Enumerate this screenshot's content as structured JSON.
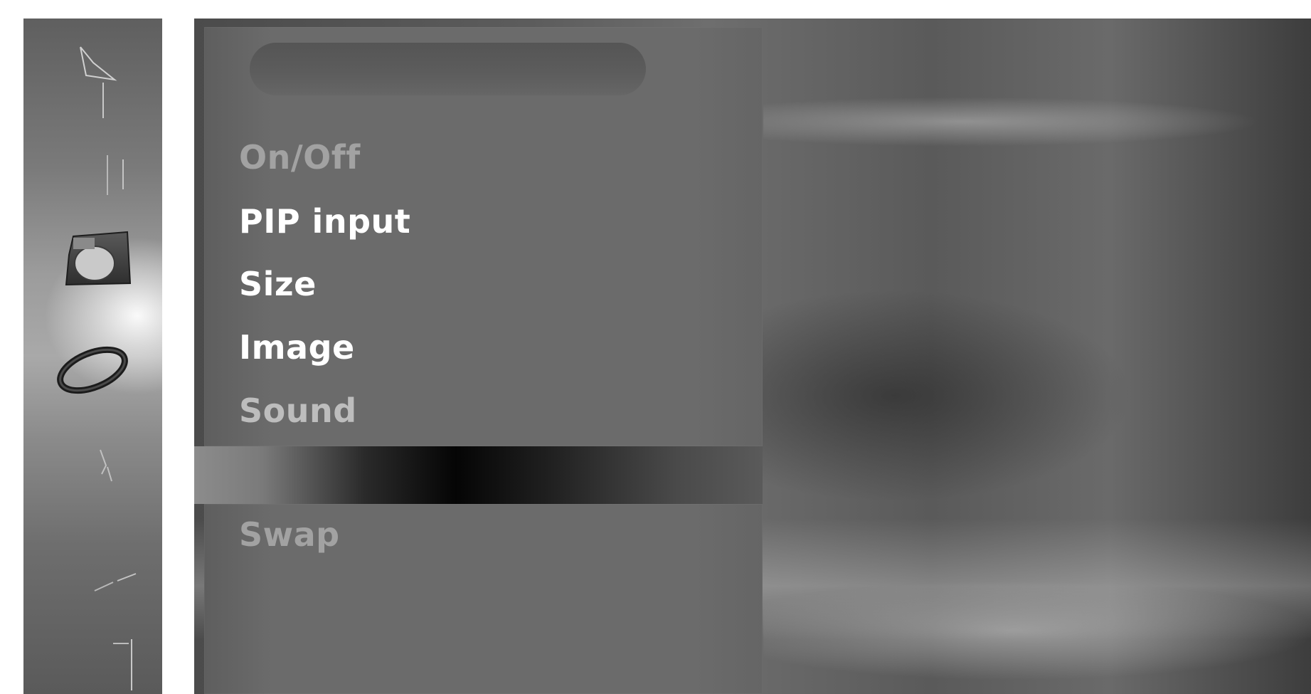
{
  "colors": {
    "item_enabled": "#ffffff",
    "item_disabled": "#a2a2a2",
    "panel": "#6a6a6a"
  },
  "sidebar": {
    "icons": [
      {
        "name": "picture-icon"
      },
      {
        "name": "sound-icon"
      },
      {
        "name": "time-icon"
      },
      {
        "name": "special-icon"
      },
      {
        "name": "screen-icon"
      },
      {
        "name": "pip-icon"
      },
      {
        "name": "input-icon"
      }
    ]
  },
  "menu": {
    "title": "",
    "items": [
      {
        "label": "On/Off",
        "state": "disabled"
      },
      {
        "label": "PIP input",
        "state": "enabled"
      },
      {
        "label": "Size",
        "state": "enabled"
      },
      {
        "label": "Image",
        "state": "enabled"
      },
      {
        "label": "Sound",
        "state": "dim"
      }
    ],
    "secondary_items": [
      {
        "label": "Swap",
        "state": "disabled"
      }
    ]
  }
}
